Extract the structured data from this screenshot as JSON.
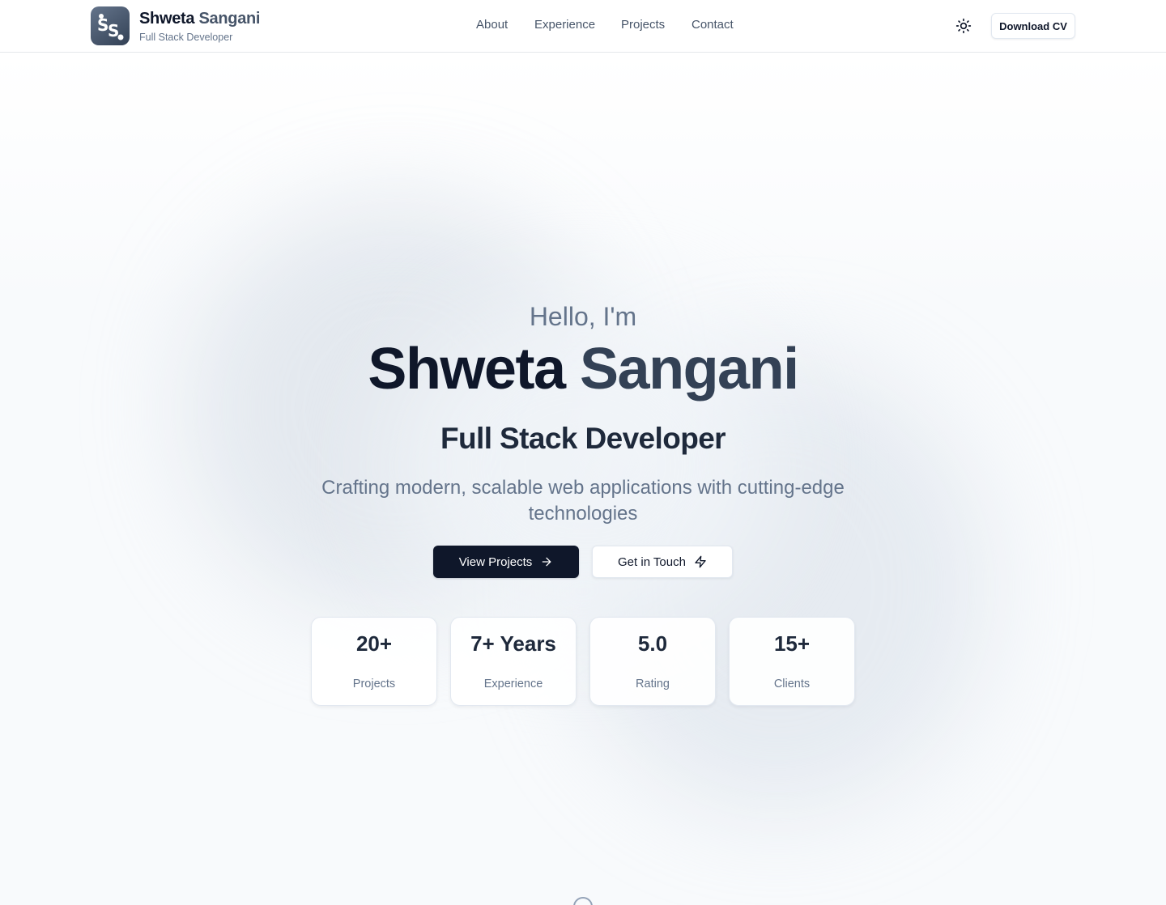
{
  "header": {
    "brand_first": "Shweta",
    "brand_last": "Sangani",
    "brand_subtitle": "Full Stack Developer",
    "logo_text": "SS",
    "nav": [
      "About",
      "Experience",
      "Projects",
      "Contact"
    ],
    "theme_toggle_icon": "sun-icon",
    "download_label": "Download CV"
  },
  "hero": {
    "greeting": "Hello, I'm",
    "name_first": "Shweta",
    "name_last": "Sangani",
    "role": "Full Stack Developer",
    "tagline": "Crafting modern, scalable web applications with cutting-edge technologies",
    "primary_cta": "View Projects",
    "primary_cta_icon": "arrow-right-icon",
    "secondary_cta": "Get in Touch",
    "secondary_cta_icon": "zap-icon",
    "stats": [
      {
        "value": "20+",
        "label": "Projects"
      },
      {
        "value": "7+ Years",
        "label": "Experience"
      },
      {
        "value": "5.0",
        "label": "Rating"
      },
      {
        "value": "15+",
        "label": "Clients"
      }
    ],
    "scroll_icon": "mouse-scroll-icon"
  },
  "colors": {
    "primary": "#0f172a",
    "muted": "#64748b",
    "accent_slate": "#334155",
    "border": "#e2e8f0"
  }
}
